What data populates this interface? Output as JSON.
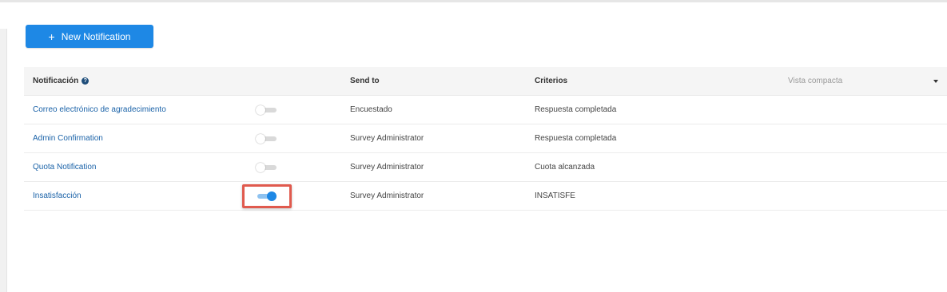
{
  "toolbar": {
    "new_button_icon": "+",
    "new_button_label": "New Notification"
  },
  "table": {
    "columns": {
      "notification": "Notificación",
      "send_to": "Send to",
      "criteria": "Criterios"
    },
    "help_icon": "?",
    "view_select": "Vista compacta",
    "rows": [
      {
        "name": "Correo electrónico de agradecimiento",
        "enabled": false,
        "send_to": "Encuestado",
        "criteria": "Respuesta completada"
      },
      {
        "name": "Admin Confirmation",
        "enabled": false,
        "send_to": "Survey Administrator",
        "criteria": "Respuesta completada"
      },
      {
        "name": "Quota Notification",
        "enabled": false,
        "send_to": "Survey Administrator",
        "criteria": "Cuota alcanzada"
      },
      {
        "name": "Insatisfacción",
        "enabled": true,
        "send_to": "Survey Administrator",
        "criteria": "INSATISFE"
      }
    ]
  },
  "colors": {
    "accent": "#1e88e5",
    "link": "#1a62a8",
    "highlight": "#e05a4e"
  }
}
